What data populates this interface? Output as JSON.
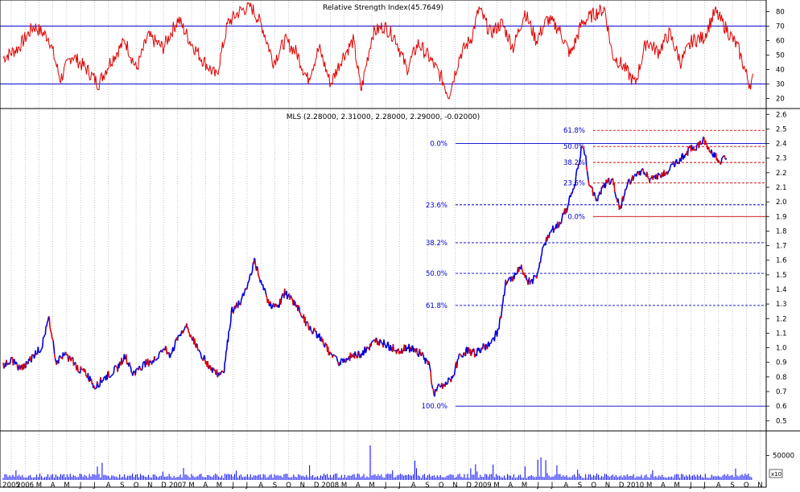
{
  "chart_data": [
    {
      "panel": "rsi",
      "type": "line",
      "title": "Relative Strength Index(45.7649)",
      "ylim": [
        13,
        88
      ],
      "yticks": [
        "20",
        "30",
        "40",
        "50",
        "60",
        "70",
        "80"
      ],
      "reference_lines": [
        70,
        30
      ],
      "series": [
        {
          "name": "RSI",
          "color": "#e00000",
          "keypoints": [
            [
              0,
              48
            ],
            [
              0.02,
              55
            ],
            [
              0.04,
              70
            ],
            [
              0.06,
              62
            ],
            [
              0.075,
              33
            ],
            [
              0.09,
              50
            ],
            [
              0.11,
              40
            ],
            [
              0.125,
              30
            ],
            [
              0.14,
              45
            ],
            [
              0.16,
              60
            ],
            [
              0.175,
              40
            ],
            [
              0.19,
              63
            ],
            [
              0.21,
              55
            ],
            [
              0.23,
              75
            ],
            [
              0.245,
              60
            ],
            [
              0.26,
              48
            ],
            [
              0.28,
              35
            ],
            [
              0.295,
              72
            ],
            [
              0.31,
              80
            ],
            [
              0.325,
              84
            ],
            [
              0.34,
              70
            ],
            [
              0.355,
              45
            ],
            [
              0.37,
              60
            ],
            [
              0.385,
              52
            ],
            [
              0.4,
              33
            ],
            [
              0.415,
              55
            ],
            [
              0.43,
              30
            ],
            [
              0.445,
              48
            ],
            [
              0.46,
              60
            ],
            [
              0.47,
              25
            ],
            [
              0.485,
              65
            ],
            [
              0.5,
              70
            ],
            [
              0.515,
              62
            ],
            [
              0.53,
              40
            ],
            [
              0.545,
              58
            ],
            [
              0.56,
              48
            ],
            [
              0.575,
              35
            ],
            [
              0.585,
              22
            ],
            [
              0.6,
              50
            ],
            [
              0.615,
              62
            ],
            [
              0.625,
              82
            ],
            [
              0.64,
              65
            ],
            [
              0.655,
              72
            ],
            [
              0.67,
              55
            ],
            [
              0.685,
              80
            ],
            [
              0.7,
              60
            ],
            [
              0.715,
              75
            ],
            [
              0.73,
              68
            ],
            [
              0.745,
              50
            ],
            [
              0.76,
              72
            ],
            [
              0.775,
              78
            ],
            [
              0.79,
              82
            ],
            [
              0.8,
              50
            ],
            [
              0.815,
              42
            ],
            [
              0.83,
              30
            ],
            [
              0.845,
              60
            ],
            [
              0.86,
              52
            ],
            [
              0.875,
              65
            ],
            [
              0.89,
              45
            ],
            [
              0.905,
              60
            ],
            [
              0.92,
              62
            ],
            [
              0.935,
              80
            ],
            [
              0.95,
              68
            ],
            [
              0.965,
              55
            ],
            [
              0.98,
              30
            ],
            [
              1.0,
              42
            ]
          ]
        }
      ]
    },
    {
      "panel": "price",
      "type": "line",
      "title": "MLS (2.28000, 2.31000, 2.28000, 2.29000, -0.02000)",
      "ylim": [
        0.43,
        2.64
      ],
      "yticks": [
        "0.5",
        "0.6",
        "0.7",
        "0.8",
        "0.9",
        "1.0",
        "1.1",
        "1.2",
        "1.3",
        "1.4",
        "1.5",
        "1.6",
        "1.7",
        "1.8",
        "1.9",
        "2.0",
        "2.1",
        "2.2",
        "2.3",
        "2.4",
        "2.5",
        "2.6"
      ],
      "x_categories": [
        "2005",
        "2006",
        "M",
        "A",
        "M",
        "J",
        "J",
        "A",
        "S",
        "O",
        "N",
        "D",
        "2007",
        "M",
        "A",
        "M",
        "J",
        "J",
        "A",
        "S",
        "O",
        "N",
        "D",
        "2008",
        "M",
        "A",
        "M",
        "J",
        "J",
        "A",
        "S",
        "O",
        "N",
        "D",
        "2009",
        "M",
        "A",
        "M",
        "J",
        "J",
        "A",
        "S",
        "O",
        "N",
        "D",
        "2010",
        "M",
        "A",
        "M",
        "J",
        "J",
        "A",
        "S",
        "O",
        "N"
      ],
      "series": [
        {
          "name": "MLS",
          "color": "#0000dd",
          "down_color": "#dd0000",
          "keypoints": [
            [
              0,
              0.88
            ],
            [
              0.01,
              0.92
            ],
            [
              0.02,
              0.86
            ],
            [
              0.03,
              0.88
            ],
            [
              0.04,
              0.95
            ],
            [
              0.05,
              1.0
            ],
            [
              0.06,
              1.2
            ],
            [
              0.07,
              0.9
            ],
            [
              0.08,
              0.95
            ],
            [
              0.09,
              0.92
            ],
            [
              0.1,
              0.85
            ],
            [
              0.11,
              0.82
            ],
            [
              0.12,
              0.73
            ],
            [
              0.13,
              0.78
            ],
            [
              0.14,
              0.82
            ],
            [
              0.15,
              0.86
            ],
            [
              0.16,
              0.95
            ],
            [
              0.17,
              0.82
            ],
            [
              0.18,
              0.87
            ],
            [
              0.19,
              0.9
            ],
            [
              0.2,
              0.92
            ],
            [
              0.21,
              1.0
            ],
            [
              0.22,
              0.95
            ],
            [
              0.23,
              1.08
            ],
            [
              0.24,
              1.15
            ],
            [
              0.25,
              1.05
            ],
            [
              0.26,
              0.95
            ],
            [
              0.27,
              0.88
            ],
            [
              0.28,
              0.82
            ],
            [
              0.29,
              0.85
            ],
            [
              0.3,
              1.25
            ],
            [
              0.31,
              1.3
            ],
            [
              0.32,
              1.4
            ],
            [
              0.33,
              1.6
            ],
            [
              0.34,
              1.42
            ],
            [
              0.35,
              1.3
            ],
            [
              0.36,
              1.28
            ],
            [
              0.37,
              1.38
            ],
            [
              0.38,
              1.32
            ],
            [
              0.39,
              1.25
            ],
            [
              0.4,
              1.15
            ],
            [
              0.41,
              1.1
            ],
            [
              0.42,
              1.05
            ],
            [
              0.43,
              0.95
            ],
            [
              0.44,
              0.9
            ],
            [
              0.45,
              0.92
            ],
            [
              0.46,
              0.95
            ],
            [
              0.47,
              0.96
            ],
            [
              0.48,
              1.0
            ],
            [
              0.49,
              1.05
            ],
            [
              0.5,
              1.03
            ],
            [
              0.51,
              1.0
            ],
            [
              0.52,
              0.98
            ],
            [
              0.53,
              1.0
            ],
            [
              0.54,
              0.99
            ],
            [
              0.55,
              0.95
            ],
            [
              0.56,
              0.88
            ],
            [
              0.565,
              0.68
            ],
            [
              0.57,
              0.72
            ],
            [
              0.58,
              0.74
            ],
            [
              0.59,
              0.8
            ],
            [
              0.6,
              0.95
            ],
            [
              0.61,
              0.98
            ],
            [
              0.62,
              0.96
            ],
            [
              0.63,
              1.0
            ],
            [
              0.64,
              1.02
            ],
            [
              0.65,
              1.12
            ],
            [
              0.655,
              1.25
            ],
            [
              0.66,
              1.45
            ],
            [
              0.67,
              1.48
            ],
            [
              0.68,
              1.55
            ],
            [
              0.69,
              1.45
            ],
            [
              0.7,
              1.48
            ],
            [
              0.71,
              1.7
            ],
            [
              0.72,
              1.8
            ],
            [
              0.73,
              1.85
            ],
            [
              0.74,
              1.95
            ],
            [
              0.75,
              2.1
            ],
            [
              0.76,
              2.38
            ],
            [
              0.765,
              2.32
            ],
            [
              0.77,
              2.1
            ],
            [
              0.78,
              2.02
            ],
            [
              0.79,
              2.12
            ],
            [
              0.8,
              2.15
            ],
            [
              0.81,
              1.95
            ],
            [
              0.82,
              2.12
            ],
            [
              0.83,
              2.18
            ],
            [
              0.84,
              2.22
            ],
            [
              0.85,
              2.15
            ],
            [
              0.86,
              2.18
            ],
            [
              0.87,
              2.2
            ],
            [
              0.88,
              2.25
            ],
            [
              0.89,
              2.3
            ],
            [
              0.9,
              2.35
            ],
            [
              0.91,
              2.38
            ],
            [
              0.92,
              2.42
            ],
            [
              0.93,
              2.35
            ],
            [
              0.94,
              2.28
            ],
            [
              0.95,
              2.3
            ]
          ]
        }
      ],
      "fibonacci": [
        {
          "name": "lower",
          "color": "#0000cc",
          "levels": [
            {
              "label": "0.0%",
              "value": 2.4,
              "style": "solid"
            },
            {
              "label": "23.6%",
              "value": 1.98,
              "style": "dashed"
            },
            {
              "label": "38.2%",
              "value": 1.72,
              "style": "dashed"
            },
            {
              "label": "50.0%",
              "value": 1.51,
              "style": "dashed"
            },
            {
              "label": "61.8%",
              "value": 1.29,
              "style": "dashed"
            },
            {
              "label": "100.0%",
              "value": 0.6,
              "style": "solid"
            }
          ]
        },
        {
          "name": "upper",
          "color": "#cc0000",
          "text_color": "#0000cc",
          "levels": [
            {
              "label": "61.8%",
              "value": 2.49,
              "style": "dashed"
            },
            {
              "label": "50.0%",
              "value": 2.38,
              "style": "dashed"
            },
            {
              "label": "38.2%",
              "value": 2.27,
              "style": "dashed"
            },
            {
              "label": "23.6%",
              "value": 2.13,
              "style": "dashed"
            },
            {
              "label": "0.0%",
              "value": 1.9,
              "style": "solid"
            }
          ]
        }
      ]
    },
    {
      "panel": "volume",
      "type": "bar",
      "ylim": [
        0,
        100000
      ],
      "yticks": [
        "50000"
      ],
      "multiplier_label": "x10",
      "color": "#0000ff"
    }
  ]
}
